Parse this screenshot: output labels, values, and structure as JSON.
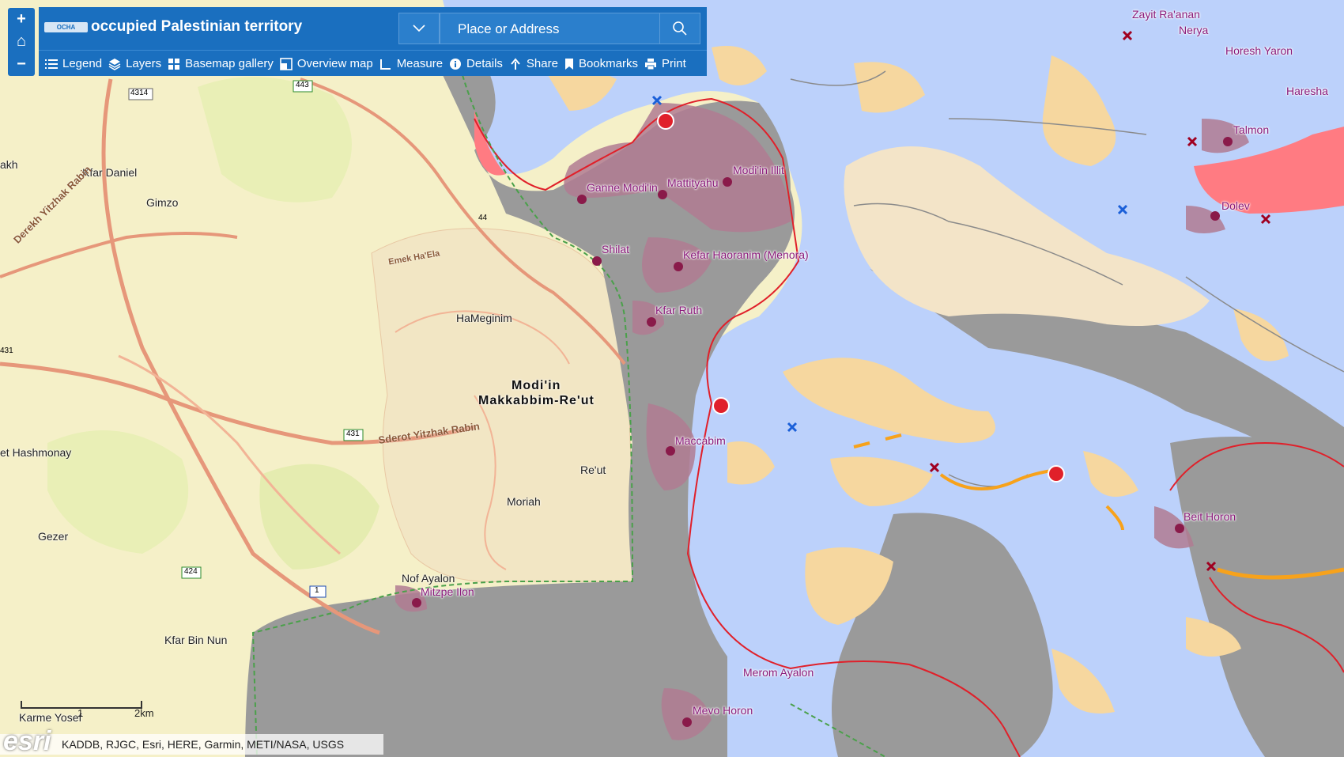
{
  "header": {
    "title": "occupied Palestinian territory",
    "logo_text": "OCHA",
    "search_placeholder": "Place or Address"
  },
  "toolbar": [
    {
      "label": "Legend",
      "icon": "list-icon"
    },
    {
      "label": "Layers",
      "icon": "layers-icon"
    },
    {
      "label": "Basemap gallery",
      "icon": "grid-icon"
    },
    {
      "label": "Overview map",
      "icon": "overview-icon"
    },
    {
      "label": "Measure",
      "icon": "ruler-icon"
    },
    {
      "label": "Details",
      "icon": "info-icon"
    },
    {
      "label": "Share",
      "icon": "share-icon"
    },
    {
      "label": "Bookmarks",
      "icon": "bookmark-icon"
    },
    {
      "label": "Print",
      "icon": "print-icon"
    }
  ],
  "zoom": {
    "in": "+",
    "home": "⌂",
    "out": "−"
  },
  "labels": {
    "settlements": [
      "Zayit Ra'anan",
      "Nerya",
      "Horesh Yaron",
      "Haresha",
      "Talmon",
      "Dolev",
      "Modi'in Illit",
      "Mattityahu",
      "Ganne Modi'in",
      "Shilat",
      "Kefar Haoranim (Menora)",
      "Kfar Ruth",
      "Maccabim",
      "Beit Horon",
      "Nof Ayalon",
      "Mitzpe Ilon",
      "Merom Ayalon",
      "Mevo Horon"
    ],
    "places": [
      "Kfar Daniel",
      "Gimzo",
      "HaMeginim",
      "Re'ut",
      "Moriah",
      "Gezer",
      "Kfar Bin Nun",
      "Karme Yosef",
      "et Hashmonay",
      "akh"
    ],
    "city_line1": "Modi'in",
    "city_line2": "Makkabbim-Re'ut",
    "roads": [
      "Derekh Yitzhak Rabin",
      "Sderot Yitzhak Rabin",
      "Emek Ha'Ela"
    ],
    "shields": [
      "4314",
      "443",
      "44",
      "431",
      "431",
      "424",
      "1"
    ]
  },
  "scalebar": {
    "label": "2km",
    "tick": "1"
  },
  "attribution": "KADDB, RJGC, Esri, HERE, Garmin, METI/NASA, USGS",
  "esri_logo": "esri",
  "colors": {
    "westbank": "#bcd1fb",
    "israel": "#f5f0c8",
    "barrier_zone": "#9a9a9a",
    "settlement": "#b07b92",
    "villages": "#f6d79f",
    "header": "#1a6fbf",
    "barrier_line": "#e0202a"
  }
}
